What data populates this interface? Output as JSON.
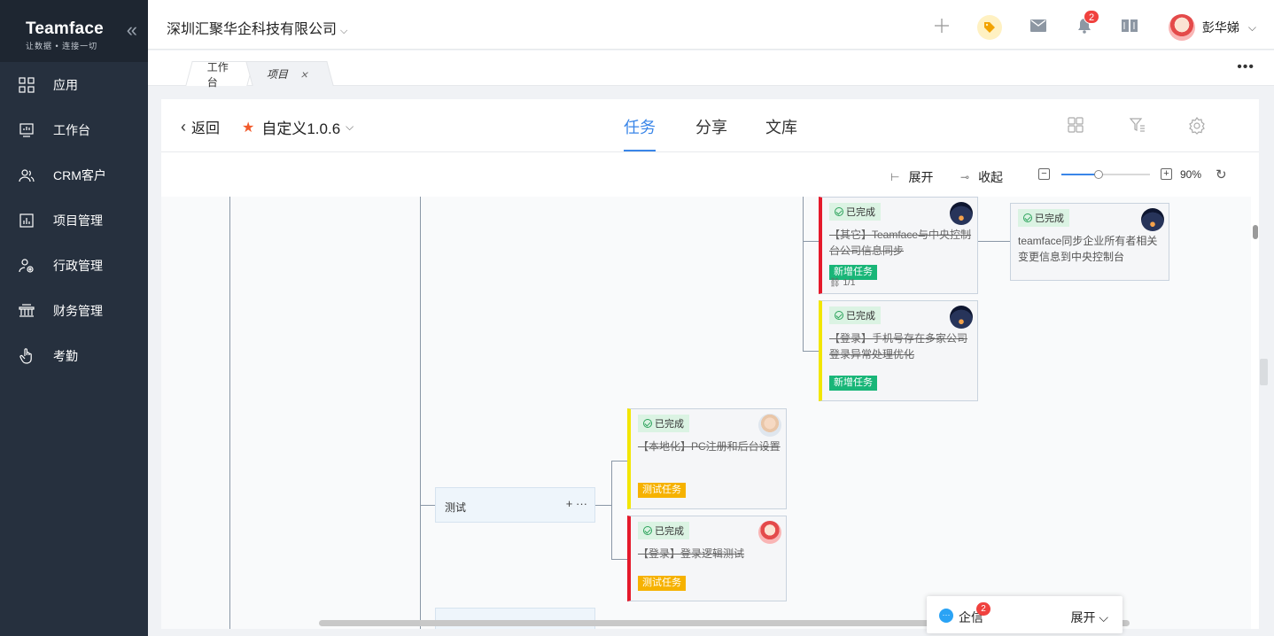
{
  "sidebar": {
    "brand": "Teamface",
    "tagline": "让数据 • 连接一切",
    "collapse_icon": "double-chevron-left-icon",
    "items": [
      {
        "label": "应用",
        "icon": "grid-icon"
      },
      {
        "label": "工作台",
        "icon": "monitor-icon"
      },
      {
        "label": "CRM客户",
        "icon": "users-icon"
      },
      {
        "label": "项目管理",
        "icon": "chart-icon"
      },
      {
        "label": "行政管理",
        "icon": "admin-icon"
      },
      {
        "label": "财务管理",
        "icon": "finance-icon"
      },
      {
        "label": "考勤",
        "icon": "hand-icon"
      }
    ]
  },
  "topbar": {
    "company": "深圳汇聚华企科技有限公司",
    "notification_count": "2",
    "user_name": "彭华娣"
  },
  "tabs": [
    {
      "label": "工作台"
    },
    {
      "label": "项目",
      "close": "×"
    }
  ],
  "project": {
    "back_label": "返回",
    "name": "自定义1.0.6",
    "tabs": [
      "任务",
      "分享",
      "文库"
    ],
    "active_tab": "任务"
  },
  "toolbar": {
    "expand_label": "展开",
    "collapse_label": "收起",
    "zoom_text": "90%",
    "zoom_percent": 90,
    "minus": "−",
    "plus": "+"
  },
  "cards": [
    {
      "status": "已完成",
      "title": "【其它】Teamface与中央控制台公司信息同步",
      "tag": "新增任务",
      "subtasks": "1/1"
    },
    {
      "status": "已完成",
      "title": "teamface同步企业所有者相关变更信息到中央控制台"
    },
    {
      "status": "已完成",
      "title": "【登录】手机号存在多家公司登录异常处理优化",
      "tag": "新增任务"
    },
    {
      "status": "已完成",
      "title": "【本地化】PC注册和后台设置",
      "tag": "测试任务"
    },
    {
      "status": "已完成",
      "title": "【登录】登录逻辑测试",
      "tag": "测试任务"
    }
  ],
  "nodes": [
    {
      "name": "测试",
      "actions": "+ ···"
    }
  ],
  "chat": {
    "label": "企信",
    "badge": "2",
    "expand_label": "展开"
  },
  "colors": {
    "sidebar_bg": "#26303e",
    "accent": "#3a86e8",
    "done_green": "#19b678",
    "test_orange": "#f6b200",
    "priority_red": "#e5192b",
    "priority_yellow": "#f2e600"
  }
}
